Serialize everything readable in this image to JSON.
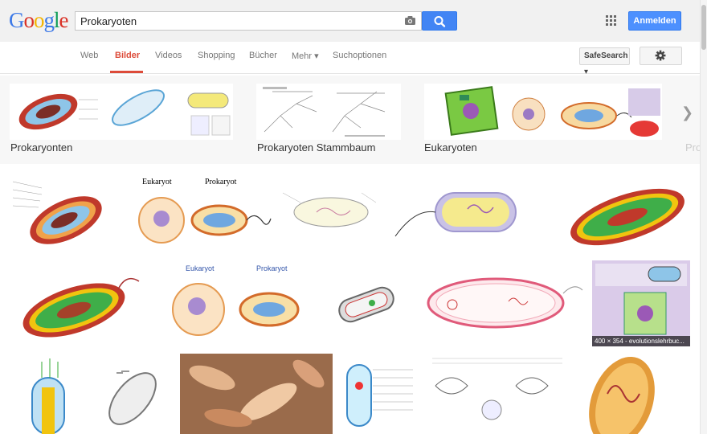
{
  "logo": {
    "letters": [
      "G",
      "o",
      "o",
      "g",
      "l",
      "e"
    ]
  },
  "search": {
    "value": "Prokaryoten"
  },
  "header": {
    "signin_label": "Anmelden"
  },
  "nav": {
    "tabs": [
      {
        "label": "Web"
      },
      {
        "label": "Bilder"
      },
      {
        "label": "Videos"
      },
      {
        "label": "Shopping"
      },
      {
        "label": "Bücher"
      },
      {
        "label": "Mehr ▾"
      },
      {
        "label": "Suchoptionen"
      }
    ],
    "active_index": 1,
    "safesearch_label": "SafeSearch ▾"
  },
  "related": [
    {
      "label": "Prokaryonten"
    },
    {
      "label": "Prokaryoten Stammbaum"
    },
    {
      "label": "Eukaryoten"
    },
    {
      "label": "Pro"
    }
  ],
  "hover_label": "400 × 354 - evolutionslehrbuc...",
  "colors": {
    "accent": "#dd4b39",
    "button_blue": "#4d90fe"
  }
}
